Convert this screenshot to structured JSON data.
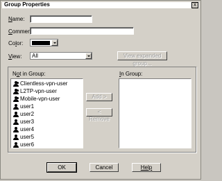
{
  "window": {
    "title": "Group Properties",
    "close_glyph": "x"
  },
  "form": {
    "name_label_u": "N",
    "name_label_rest": "ame:",
    "name_value": "",
    "comment_label_u": "C",
    "comment_label_rest": "omment:",
    "comment_value": "",
    "color_label_rest_pre": "Co",
    "color_label_u": "l",
    "color_label_rest": "or:",
    "color_value": "#000000",
    "view_label_u": "V",
    "view_label_rest": "iew:",
    "view_value": "All",
    "view_expanded_button": "View expanded group..."
  },
  "not_in_group": {
    "label_pre": "N",
    "label_u": "o",
    "label_rest": "t in Group:",
    "items": [
      {
        "label": "Clientless-vpn-user",
        "icon": "group-icon"
      },
      {
        "label": "L2TP-vpn-user",
        "icon": "group-icon"
      },
      {
        "label": "Mobile-vpn-user",
        "icon": "group-icon"
      },
      {
        "label": "user1",
        "icon": "user-icon"
      },
      {
        "label": "user2",
        "icon": "user-icon"
      },
      {
        "label": "user3",
        "icon": "user-icon"
      },
      {
        "label": "user4",
        "icon": "user-icon"
      },
      {
        "label": "user5",
        "icon": "user-icon"
      },
      {
        "label": "user6",
        "icon": "user-icon"
      }
    ]
  },
  "in_group": {
    "label_u": "I",
    "label_rest": "n Group:",
    "items": []
  },
  "buttons": {
    "add": "Add >",
    "remove": "< Remove",
    "ok": "OK",
    "cancel": "Cancel",
    "help": "Help"
  }
}
